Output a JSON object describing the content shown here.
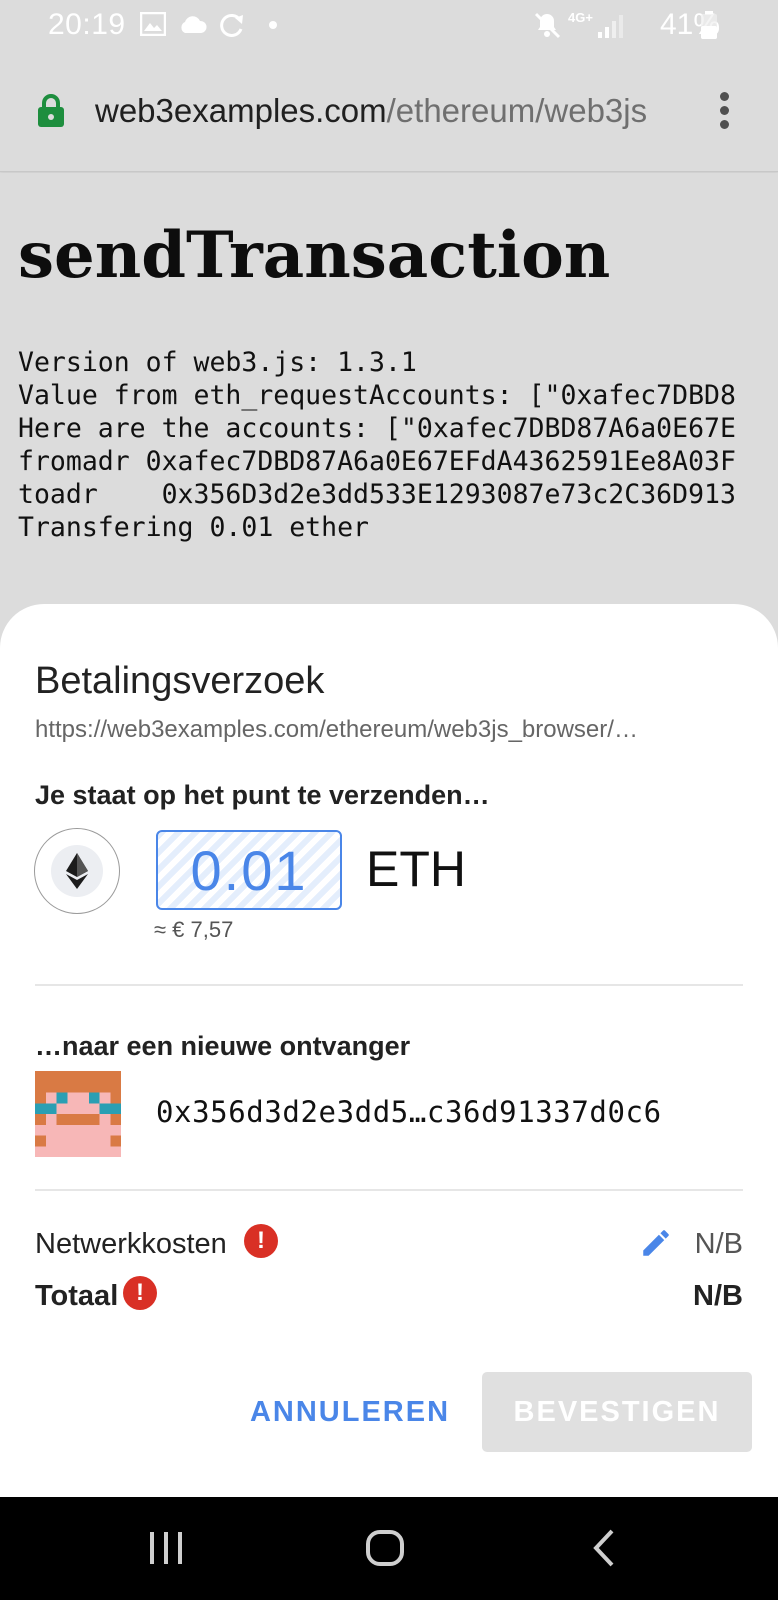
{
  "status_bar": {
    "time": "20:19",
    "network": "4G+",
    "battery": "41%",
    "icons": [
      "image-icon",
      "cloud-icon",
      "sync-icon",
      "dot-icon",
      "mute-icon",
      "signal-icon",
      "battery-icon"
    ]
  },
  "browser": {
    "url_domain": "web3examples.com",
    "url_path": "/ethereum/web3js",
    "lock_color": "#1e8e3e"
  },
  "page": {
    "title": "sendTransaction",
    "log_lines": [
      "Version of web3.js: 1.3.1",
      "Value from eth_requestAccounts: [\"0xafec7DBD8",
      "Here are the accounts: [\"0xafec7DBD87A6a0E67E",
      "fromadr 0xafec7DBD87A6a0E67EFdA4362591Ee8A03F",
      "toadr    0x356D3d2e3dd533E1293087e73c2C36D913",
      "Transfering 0.01 ether"
    ]
  },
  "sheet": {
    "title": "Betalingsverzoek",
    "origin_url": "https://web3examples.com/ethereum/web3js_browser/…",
    "send_heading": "Je staat op het punt te verzenden…",
    "amount": "0.01",
    "unit": "ETH",
    "fiat": "≈ € 7,57",
    "recipient_heading": "…naar een nieuwe ontvanger",
    "recipient_address": "0x356d3d2e3dd5…c36d91337d0c6",
    "fee_label": "Netwerkkosten",
    "fee_value": "N/B",
    "total_label": "Totaal",
    "total_value": "N/B",
    "warn_glyph": "!",
    "cancel_label": "ANNULEREN",
    "confirm_label": "BEVESTIGEN",
    "accent_color": "#4a86e8",
    "warning_color": "#d93025"
  }
}
